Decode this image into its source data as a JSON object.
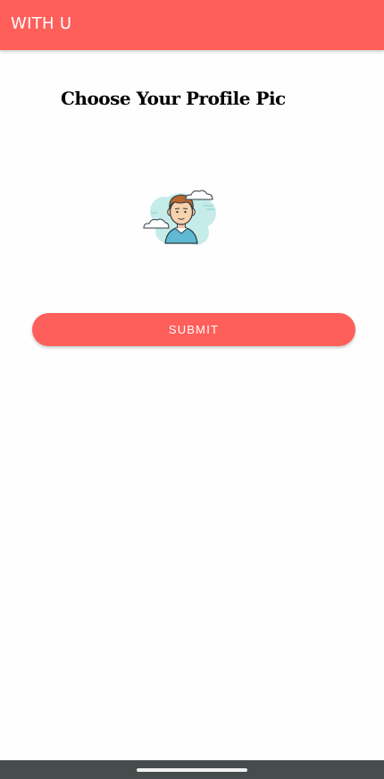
{
  "app_bar": {
    "title": "WITH U",
    "color": "#fe5f5a"
  },
  "main": {
    "heading": "Choose Your Profile Pic",
    "avatar": {
      "icon": "profile-avatar-icon"
    },
    "submit_label": "SUBMIT"
  },
  "system_nav": {
    "icon": "home-indicator"
  }
}
